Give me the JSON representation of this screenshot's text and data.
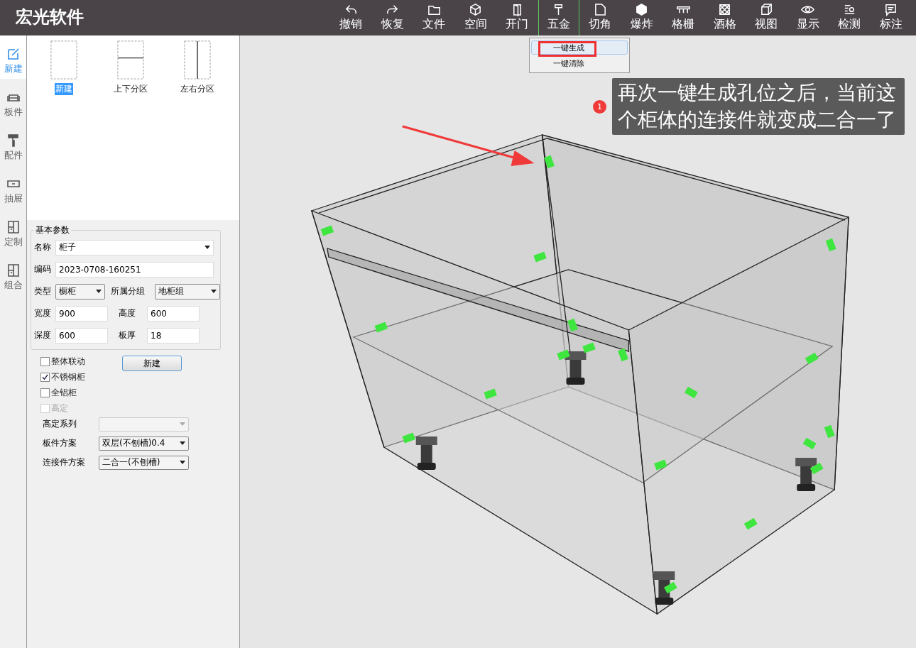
{
  "app": {
    "title": "宏光软件"
  },
  "toolbar": [
    {
      "label": "撤销",
      "selected": false
    },
    {
      "label": "恢复",
      "selected": false
    },
    {
      "label": "文件",
      "selected": false
    },
    {
      "label": "空间",
      "selected": false
    },
    {
      "label": "开门",
      "selected": false
    },
    {
      "label": "五金",
      "selected": true
    },
    {
      "label": "切角",
      "selected": false
    },
    {
      "label": "爆炸",
      "selected": false
    },
    {
      "label": "格栅",
      "selected": false
    },
    {
      "label": "酒格",
      "selected": false
    },
    {
      "label": "视图",
      "selected": false
    },
    {
      "label": "显示",
      "selected": false
    },
    {
      "label": "检测",
      "selected": false
    },
    {
      "label": "标注",
      "selected": false
    }
  ],
  "hardware_menu": [
    {
      "label": "一键生成",
      "selected": true,
      "highlighted": true
    },
    {
      "label": "一键清除",
      "selected": false,
      "highlighted": false
    }
  ],
  "side_tabs": [
    {
      "label": "新建",
      "selected": true
    },
    {
      "label": "板件",
      "selected": false
    },
    {
      "label": "配件",
      "selected": false
    },
    {
      "label": "抽屉",
      "selected": false
    },
    {
      "label": "定制",
      "selected": false
    },
    {
      "label": "组合",
      "selected": false
    }
  ],
  "templates": [
    {
      "label": "新建",
      "kind": "plain",
      "selected": true
    },
    {
      "label": "上下分区",
      "kind": "horizontal",
      "selected": false
    },
    {
      "label": "左右分区",
      "kind": "vertical",
      "selected": false
    }
  ],
  "basic_params": {
    "title": "基本参数",
    "name": {
      "label": "名称",
      "value": "柜子"
    },
    "code": {
      "label": "编码",
      "value": "2023-0708-160251"
    },
    "type": {
      "label": "类型",
      "value": "橱柜"
    },
    "group": {
      "label": "所属分组",
      "value": "地柜组"
    },
    "width": {
      "label": "宽度",
      "value": "900"
    },
    "height": {
      "label": "高度",
      "value": "600"
    },
    "depth": {
      "label": "深度",
      "value": "600"
    },
    "thickness": {
      "label": "板厚",
      "value": "18"
    }
  },
  "options": [
    {
      "label": "整体联动",
      "checked": false,
      "disabled": false
    },
    {
      "label": "不锈钢柜",
      "checked": true,
      "disabled": false
    },
    {
      "label": "全铝柜",
      "checked": false,
      "disabled": false
    },
    {
      "label": "高定",
      "checked": false,
      "disabled": true
    }
  ],
  "create_button": "新建",
  "selects": [
    {
      "label": "高定系列",
      "disabled": true
    },
    {
      "label": "板件方案",
      "value": "双层(不刨槽)0.4",
      "disabled": false
    },
    {
      "label": "连接件方案",
      "value": "二合一(不刨槽)",
      "disabled": false
    }
  ],
  "callout": {
    "badge": "1",
    "text": "再次一键生成孔位之后，当前这个柜体的连接件就变成二合一了"
  }
}
